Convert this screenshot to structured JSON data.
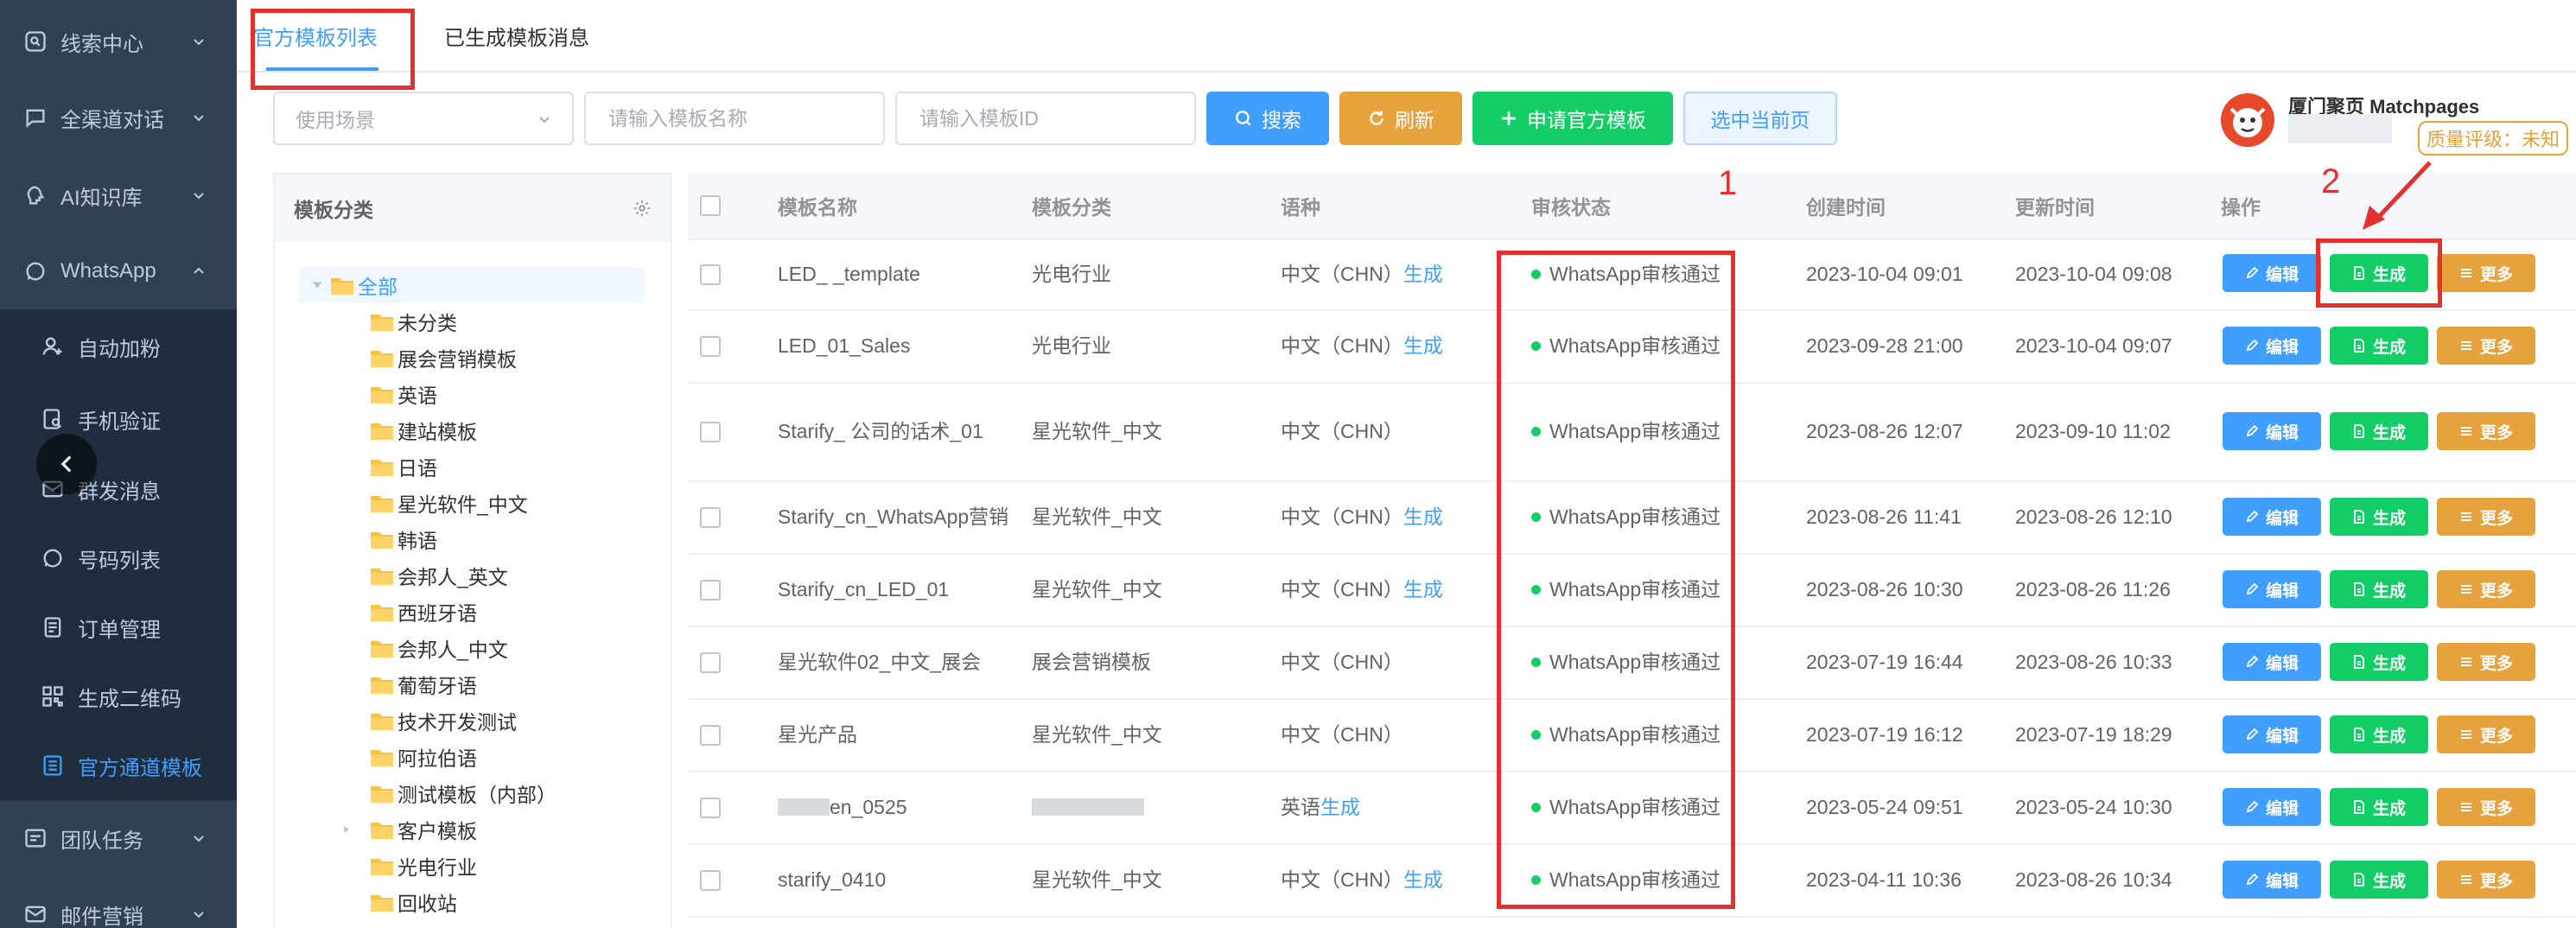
{
  "sidebar": {
    "items": [
      {
        "label": "线索中心",
        "icon": "clue-icon",
        "type": "top",
        "expanded": false
      },
      {
        "label": "全渠道对话",
        "icon": "chat-icon",
        "type": "top",
        "expanded": false
      },
      {
        "label": "AI知识库",
        "icon": "brain-icon",
        "type": "top",
        "expanded": false
      },
      {
        "label": "WhatsApp",
        "icon": "whatsapp-icon",
        "type": "top",
        "expanded": true
      },
      {
        "label": "自动加粉",
        "icon": "user-add-icon",
        "type": "sub"
      },
      {
        "label": "手机验证",
        "icon": "verify-icon",
        "type": "sub"
      },
      {
        "label": "群发消息",
        "icon": "mail-icon",
        "type": "sub"
      },
      {
        "label": "号码列表",
        "icon": "whatsapp-icon",
        "type": "sub"
      },
      {
        "label": "订单管理",
        "icon": "order-icon",
        "type": "sub"
      },
      {
        "label": "生成二维码",
        "icon": "qrcode-icon",
        "type": "sub"
      },
      {
        "label": "官方通道模板",
        "icon": "template-icon",
        "type": "sub",
        "active": true
      },
      {
        "label": "团队任务",
        "icon": "task-icon",
        "type": "top",
        "expanded": false
      },
      {
        "label": "邮件营销",
        "icon": "email-icon",
        "type": "top",
        "expanded": false
      }
    ]
  },
  "tabs": {
    "official": "官方模板列表",
    "generated": "已生成模板消息"
  },
  "filters": {
    "scene_placeholder": "使用场景",
    "name_placeholder": "请输入模板名称",
    "id_placeholder": "请输入模板ID"
  },
  "buttons": {
    "search": "搜索",
    "refresh": "刷新",
    "apply": "申请官方模板",
    "select_page": "选中当前页"
  },
  "account": {
    "name": "厦门聚页 Matchpages",
    "quality": "质量评级：未知"
  },
  "tree": {
    "header": "模板分类",
    "root": "全部",
    "children": [
      "未分类",
      "展会营销模板",
      "英语",
      "建站模板",
      "日语",
      "星光软件_中文",
      "韩语",
      "会邦人_英文",
      "西班牙语",
      "会邦人_中文",
      "葡萄牙语",
      "技术开发测试",
      "阿拉伯语",
      "测试模板（内部）",
      "客户模板",
      "光电行业",
      "回收站"
    ]
  },
  "table": {
    "columns": [
      "模板名称",
      "模板分类",
      "语种",
      "审核状态",
      "创建时间",
      "更新时间",
      "操作"
    ],
    "rows": [
      {
        "name": "LED_ _template",
        "category": "光电行业",
        "lang": "中文（CHN）",
        "gen": "生成",
        "status": "WhatsApp审核通过",
        "created": "2023-10-04 09:01",
        "updated": "2023-10-04 09:08"
      },
      {
        "name": "LED_01_Sales",
        "category": "光电行业",
        "lang": "中文（CHN）",
        "gen": "生成",
        "status": "WhatsApp审核通过",
        "created": "2023-09-28 21:00",
        "updated": "2023-10-04 09:07"
      },
      {
        "name": "Starify_ 公司的话术_01",
        "category": "星光软件_中文",
        "lang": "中文（CHN）",
        "gen": "",
        "status": "WhatsApp审核通过",
        "created": "2023-08-26 12:07",
        "updated": "2023-09-10 11:02"
      },
      {
        "name": "Starify_cn_WhatsApp营销",
        "category": "星光软件_中文",
        "lang": "中文（CHN）",
        "gen": "生成",
        "status": "WhatsApp审核通过",
        "created": "2023-08-26 11:41",
        "updated": "2023-08-26 12:10"
      },
      {
        "name": "Starify_cn_LED_01",
        "category": "星光软件_中文",
        "lang": "中文（CHN）",
        "gen": "生成",
        "status": "WhatsApp审核通过",
        "created": "2023-08-26 10:30",
        "updated": "2023-08-26 11:26"
      },
      {
        "name": "星光软件02_中文_展会",
        "category": "展会营销模板",
        "lang": "中文（CHN）",
        "gen": "",
        "status": "WhatsApp审核通过",
        "created": "2023-07-19 16:44",
        "updated": "2023-08-26 10:33"
      },
      {
        "name": "星光产品",
        "category": "星光软件_中文",
        "lang": "中文（CHN）",
        "gen": "",
        "status": "WhatsApp审核通过",
        "created": "2023-07-19 16:12",
        "updated": "2023-07-19 18:29"
      },
      {
        "name": "en_0525",
        "category": "",
        "lang": "英语",
        "gen": "生成",
        "status": "WhatsApp审核通过",
        "created": "2023-05-24 09:51",
        "updated": "2023-05-24 10:30"
      },
      {
        "name": "starify_0410",
        "category": "星光软件_中文",
        "lang": "中文（CHN）",
        "gen": "生成",
        "status": "WhatsApp审核通过",
        "created": "2023-04-11 10:36",
        "updated": "2023-08-26 10:34"
      }
    ],
    "actions": {
      "edit": "编辑",
      "generate": "生成",
      "more": "更多"
    }
  },
  "annotations": {
    "one": "1",
    "two": "2"
  },
  "colors": {
    "sidebar_bg": "#304156",
    "primary": "#409eff",
    "success": "#13ce66",
    "warning": "#e6a23c",
    "annotation": "#e53030"
  }
}
